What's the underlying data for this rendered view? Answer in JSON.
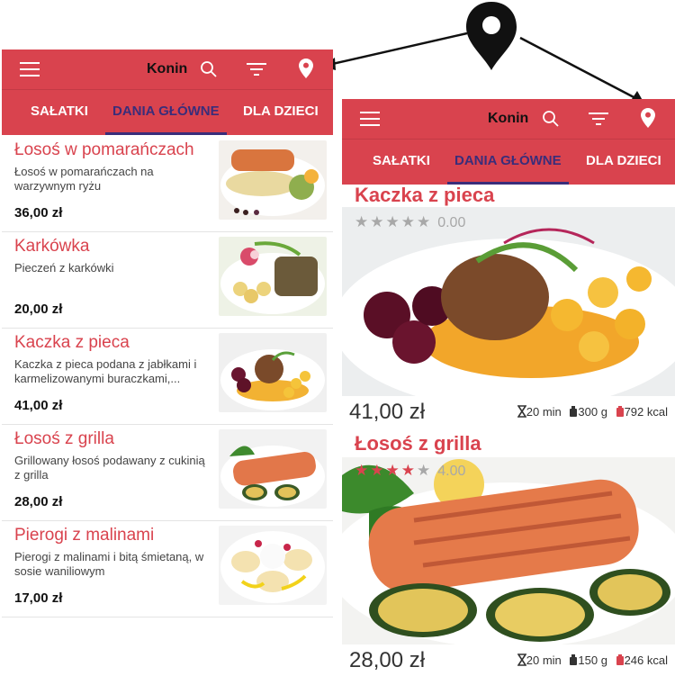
{
  "header": {
    "city": "Konin"
  },
  "icons": {
    "menu": "hamburger-menu-icon",
    "search": "search-icon",
    "filter": "filter-icon",
    "location": "location-pin-icon"
  },
  "colors": {
    "brand": "#d9434e",
    "active_tab": "#3a2d7a",
    "star_off": "#a8a8a8"
  },
  "tabs": [
    {
      "label": "SAŁATKI",
      "active": false
    },
    {
      "label": "DANIA GŁÓWNE",
      "active": true
    },
    {
      "label": "DLA DZIECI",
      "active": false
    }
  ],
  "list_items": [
    {
      "name": "Łosoś w pomarańczach",
      "description": "Łosoś w pomarańczach na warzywnym ryżu",
      "price": "36,00 zł"
    },
    {
      "name": "Karkówka",
      "description": "Pieczeń z karkówki",
      "price": "20,00 zł"
    },
    {
      "name": "Kaczka z pieca",
      "description": "Kaczka z pieca podana z jabłkami i karmelizowanymi buraczkami,...",
      "price": "41,00 zł"
    },
    {
      "name": "Łosoś z grilla",
      "description": "Grillowany łosoś podawany z cukinią z grilla",
      "price": "28,00 zł"
    },
    {
      "name": "Pierogi z malinami",
      "description": "Pierogi z malinami i bitą śmietaną, w sosie waniliowym",
      "price": "17,00 zł"
    }
  ],
  "cards": [
    {
      "name": "Kaczka z pieca",
      "stars": 0,
      "rating": "0.00",
      "price": "41,00 zł",
      "time": "20 min",
      "weight": "300 g",
      "kcal": "792 kcal"
    },
    {
      "name": "Łosoś z grilla",
      "stars": 4,
      "rating": "4.00",
      "price": "28,00 zł",
      "time": "20 min",
      "weight": "150 g",
      "kcal": "246 kcal"
    }
  ]
}
